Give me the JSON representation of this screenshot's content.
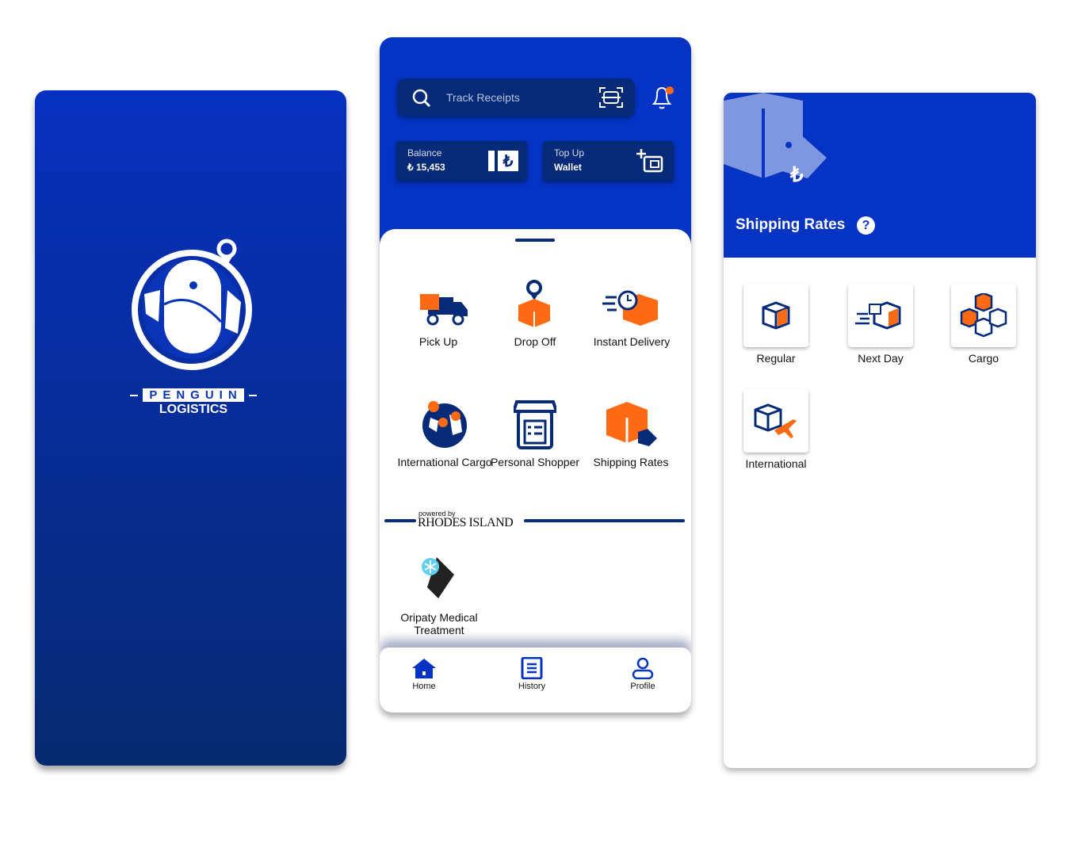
{
  "splash": {
    "brand_top": "PENGUIN",
    "brand_bottom": "LOGISTICS"
  },
  "home": {
    "search": {
      "placeholder": "Track Receipts"
    },
    "balance": {
      "label": "Balance",
      "value": "₺ 15,453"
    },
    "topup": {
      "label": "Top Up",
      "sub": "Wallet"
    },
    "services": [
      {
        "label": "Pick Up",
        "icon": "truck-icon"
      },
      {
        "label": "Drop Off",
        "icon": "box-pin-icon"
      },
      {
        "label": "Instant Delivery",
        "icon": "fast-box-icon"
      },
      {
        "label": "International Cargo",
        "icon": "globe-pin-icon"
      },
      {
        "label": "Personal Shopper",
        "icon": "shop-icon"
      },
      {
        "label": "Shipping Rates",
        "icon": "box-tag-icon"
      }
    ],
    "powered_by": "powered by",
    "partner": "RHODES ISLAND",
    "partner_services": [
      {
        "label": "Oripaty Medical Treatment",
        "icon": "medical-icon"
      }
    ],
    "nav": [
      {
        "label": "Home"
      },
      {
        "label": "History"
      },
      {
        "label": "Profile"
      }
    ],
    "colors": {
      "primary": "#0533c4",
      "dark": "#052a78",
      "accent": "#ff6a13"
    }
  },
  "rates": {
    "title": "Shipping Rates",
    "options": [
      {
        "label": "Regular"
      },
      {
        "label": "Next Day"
      },
      {
        "label": "Cargo"
      },
      {
        "label": "International"
      }
    ]
  }
}
